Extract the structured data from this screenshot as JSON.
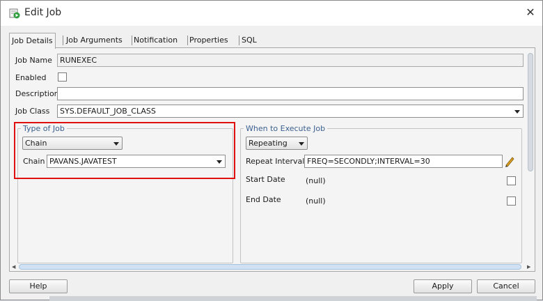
{
  "window": {
    "title": "Edit Job",
    "close_glyph": "✕"
  },
  "tabs": [
    {
      "label": "Job Details",
      "active": true
    },
    {
      "label": "Job Arguments",
      "active": false
    },
    {
      "label": "Notification",
      "active": false
    },
    {
      "label": "Properties",
      "active": false
    },
    {
      "label": "SQL",
      "active": false
    }
  ],
  "details": {
    "job_name_label": "Job Name",
    "job_name_value": "RUNEXEC",
    "enabled_label": "Enabled",
    "enabled_checked": false,
    "description_label": "Description",
    "description_value": "",
    "job_class_label": "Job Class",
    "job_class_value": "SYS.DEFAULT_JOB_CLASS"
  },
  "type_of_job": {
    "title": "Type of Job",
    "type_value": "Chain",
    "chain_label": "Chain",
    "chain_value": "PAVANS.JAVATEST"
  },
  "when_to_execute": {
    "title": "When to Execute Job",
    "mode_value": "Repeating",
    "repeat_interval_label": "Repeat Interval",
    "repeat_interval_value": "FREQ=SECONDLY;INTERVAL=30",
    "start_date_label": "Start Date",
    "start_date_value": "(null)",
    "end_date_label": "End Date",
    "end_date_value": "(null)"
  },
  "buttons": {
    "help": "Help",
    "apply": "Apply",
    "cancel": "Cancel"
  },
  "colors": {
    "highlight": "#e01010",
    "group_title": "#3a5f8f"
  },
  "icons": {
    "title": "edit-job-icon",
    "pencil": "pencil-icon"
  }
}
